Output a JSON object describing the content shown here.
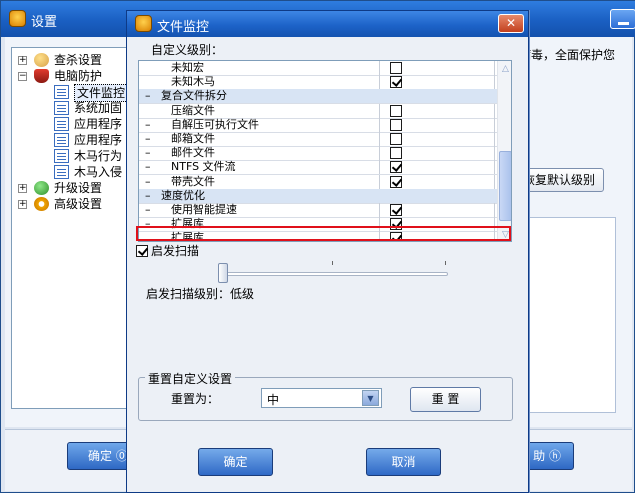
{
  "background_window": {
    "title": "设置",
    "right_text": "病毒，全面保护您",
    "restore_button_label": "恢复默认级别",
    "ok_button_label": "确定 ⓪",
    "help_button_label": "助 ⓗ",
    "tree": [
      {
        "label": "查杀设置",
        "indent": 0,
        "expander": "+",
        "icon": "user-search-icon"
      },
      {
        "label": "电脑防护",
        "indent": 0,
        "expander": "−",
        "icon": "shield-icon"
      },
      {
        "label": "文件监控",
        "indent": 1,
        "icon": "document-icon",
        "selected": true
      },
      {
        "label": "系统加固",
        "indent": 1,
        "icon": "document-icon"
      },
      {
        "label": "应用程序",
        "indent": 1,
        "icon": "document-icon"
      },
      {
        "label": "应用程序",
        "indent": 1,
        "icon": "document-icon"
      },
      {
        "label": "木马行为",
        "indent": 1,
        "icon": "document-icon"
      },
      {
        "label": "木马入侵",
        "indent": 1,
        "icon": "document-icon"
      },
      {
        "label": "升级设置",
        "indent": 0,
        "expander": "+",
        "icon": "globe-icon"
      },
      {
        "label": "高级设置",
        "indent": 0,
        "expander": "+",
        "icon": "gear-icon"
      }
    ]
  },
  "dialog": {
    "title": "文件监控",
    "close_glyph": "✕",
    "section_label": "自定义级别：",
    "list_rows": [
      {
        "label": "未知宏",
        "type": "item",
        "checked": false,
        "dash": false
      },
      {
        "label": "未知木马",
        "type": "item",
        "checked": true,
        "dash": false
      },
      {
        "label": "复合文件拆分",
        "type": "group",
        "dash": true
      },
      {
        "label": "压缩文件",
        "type": "item",
        "checked": false,
        "dash": false
      },
      {
        "label": "自解压可执行文件",
        "type": "item",
        "checked": false,
        "dash": true
      },
      {
        "label": "邮箱文件",
        "type": "item",
        "checked": false,
        "dash": true
      },
      {
        "label": "邮件文件",
        "type": "item",
        "checked": false,
        "dash": true
      },
      {
        "label": "NTFS 文件流",
        "type": "item",
        "checked": true,
        "dash": true
      },
      {
        "label": "带壳文件",
        "type": "item",
        "checked": true,
        "dash": true
      },
      {
        "label": "速度优化",
        "type": "group",
        "dash": true
      },
      {
        "label": "使用智能提速",
        "type": "item",
        "checked": true,
        "dash": true
      },
      {
        "label": "扩展库",
        "type": "item",
        "checked": true,
        "dash": true
      },
      {
        "label": "扩展库",
        "type": "item",
        "checked": true,
        "dash": false
      }
    ],
    "heuristic_label": "启发扫描",
    "heuristic_checked": true,
    "heuristic_level_label": "启发扫描级别：低级",
    "heuristic_level_fraction": 0.0,
    "reset_group_label": "重置自定义设置",
    "reset_to_label": "重置为：",
    "reset_value": "中",
    "reset_button_label": "重 置",
    "ok_button_label": "确定",
    "cancel_button_label": "取消"
  }
}
